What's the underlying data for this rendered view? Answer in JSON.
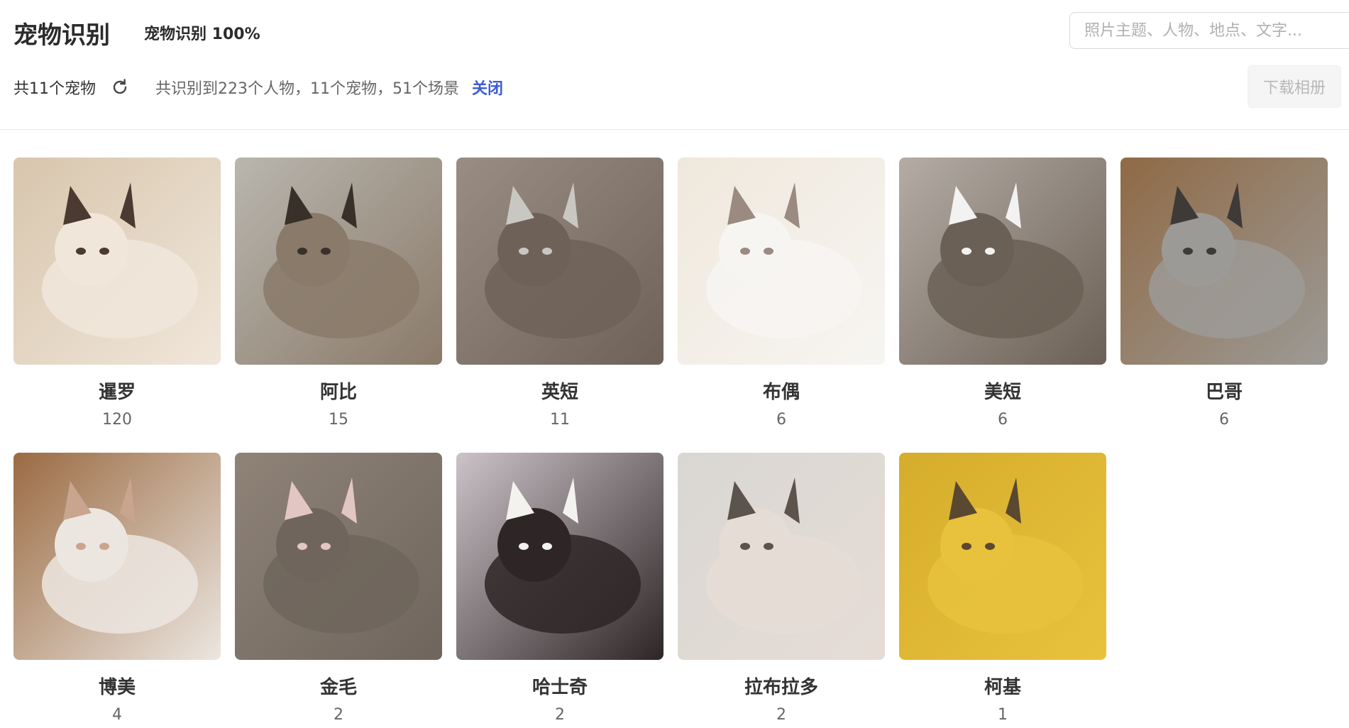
{
  "header": {
    "title": "宠物识别",
    "status": "宠物识别 100%"
  },
  "search": {
    "placeholder": "照片主题、人物、地点、文字..."
  },
  "subbar": {
    "pet_count": "共11个宠物",
    "summary": "共识别到223个人物，11个宠物，51个场景",
    "close_label": "关闭",
    "download_label": "下载相册"
  },
  "pets": [
    {
      "name": "暹罗",
      "count": "120",
      "bg": "#d8c6ad",
      "fg": "#f0e6da",
      "accent": "#4a3a32"
    },
    {
      "name": "阿比",
      "count": "15",
      "bg": "#b9b6ae",
      "fg": "#8a7a6a",
      "accent": "#3a302a"
    },
    {
      "name": "英短",
      "count": "11",
      "bg": "#9a8e84",
      "fg": "#6e6258",
      "accent": "#c9c7c2"
    },
    {
      "name": "布偶",
      "count": "6",
      "bg": "#efe8dc",
      "fg": "#f7f5f2",
      "accent": "#9a8a80"
    },
    {
      "name": "美短",
      "count": "6",
      "bg": "#b4aca5",
      "fg": "#6b6055",
      "accent": "#f2f2f2"
    },
    {
      "name": "巴哥",
      "count": "6",
      "bg": "#8f6a45",
      "fg": "#9c9a96",
      "accent": "#3d3a38"
    },
    {
      "name": "博美",
      "count": "4",
      "bg": "#9a6b43",
      "fg": "#ece6e0",
      "accent": "#c9a48f"
    },
    {
      "name": "金毛",
      "count": "2",
      "bg": "#8f8378",
      "fg": "#6f655c",
      "accent": "#e2c6c4"
    },
    {
      "name": "哈士奇",
      "count": "2",
      "bg": "#cbc3c8",
      "fg": "#2e2626",
      "accent": "#f4f2ee"
    },
    {
      "name": "拉布拉多",
      "count": "2",
      "bg": "#d9d7d3",
      "fg": "#e6dcd6",
      "accent": "#5c534c"
    },
    {
      "name": "柯基",
      "count": "1",
      "bg": "#d5ad2c",
      "fg": "#e8c23d",
      "accent": "#5a4830"
    }
  ]
}
